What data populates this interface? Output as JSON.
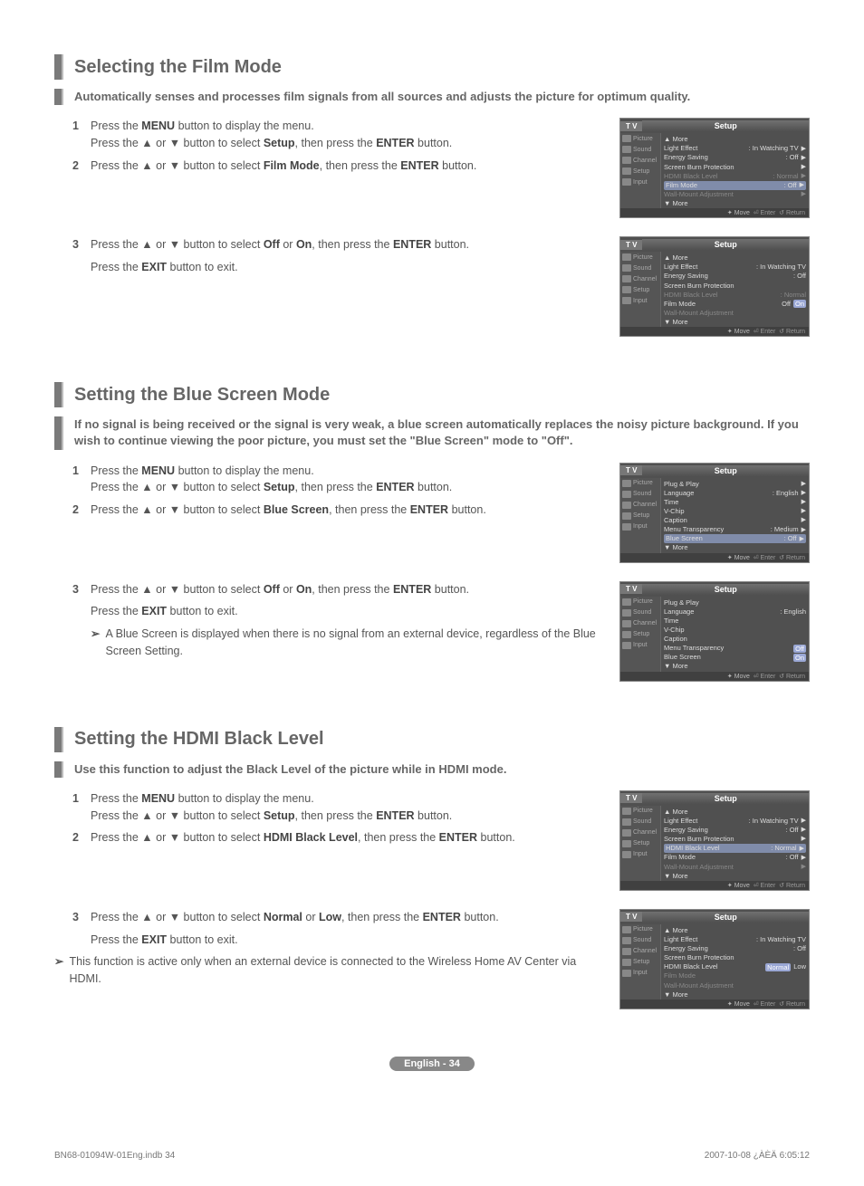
{
  "sections": [
    {
      "title": "Selecting the Film Mode",
      "subtitle": "Automatically senses and processes film signals from all sources and adjusts the picture for optimum quality.",
      "blocks": [
        {
          "steps": [
            {
              "n": "1",
              "pre": "Press the ",
              "b1": "MENU",
              "mid1": " button to display the menu.\nPress the ▲ or ▼ button to select ",
              "b2": "Setup",
              "mid2": ", then press the ",
              "b3": "ENTER",
              "post": " button."
            },
            {
              "n": "2",
              "pre": "Press the ▲ or ▼ button to select ",
              "b1": "Film Mode",
              "mid1": ", then press the ",
              "b2": "ENTER",
              "post": " button."
            }
          ],
          "osd": {
            "title": "Setup",
            "tv": "T V",
            "side": [
              "Picture",
              "Sound",
              "Channel",
              "Setup",
              "Input"
            ],
            "rows": [
              {
                "l": "▲ More",
                "type": "more"
              },
              {
                "l": "Light Effect",
                "r": ": In Watching TV",
                "arrow": true
              },
              {
                "l": "Energy Saving",
                "r": ": Off",
                "arrow": true
              },
              {
                "l": "Screen Burn Protection",
                "arrow": true
              },
              {
                "l": "HDMI Black Level",
                "r": ": Normal",
                "dim": true,
                "arrow": true
              },
              {
                "l": "Film Mode",
                "r": ": Off",
                "hl": true,
                "arrow": true
              },
              {
                "l": "Wall-Mount Adjustment",
                "dim": true,
                "arrow": true
              },
              {
                "l": "▼ More",
                "type": "more"
              }
            ],
            "foot": {
              "move": "Move",
              "enter": "Enter",
              "ret": "Return"
            }
          }
        },
        {
          "steps": [
            {
              "n": "3",
              "pre": "Press the ▲ or ▼ button to select ",
              "b1": "Off",
              "mid1": " or ",
              "b2": "On",
              "mid2": ", then press the ",
              "b3": "ENTER",
              "post": " button."
            },
            {
              "text": "Press the ",
              "b1": "EXIT",
              "post": " button to exit."
            }
          ],
          "osd": {
            "title": "Setup",
            "tv": "T V",
            "side": [
              "Picture",
              "Sound",
              "Channel",
              "Setup",
              "Input"
            ],
            "rows": [
              {
                "l": "▲ More",
                "type": "more"
              },
              {
                "l": "Light Effect",
                "r": ": In Watching TV"
              },
              {
                "l": "Energy Saving",
                "r": ": Off"
              },
              {
                "l": "Screen Burn Protection"
              },
              {
                "l": "HDMI Black Level",
                "r": ": Normal",
                "dim": true
              },
              {
                "l": "Film Mode",
                "opt1": "Off",
                "opt2": "On",
                "sel": 2
              },
              {
                "l": "Wall-Mount Adjustment",
                "dim": true
              },
              {
                "l": "▼ More",
                "type": "more"
              }
            ],
            "foot": {
              "move": "Move",
              "enter": "Enter",
              "ret": "Return"
            }
          }
        }
      ]
    },
    {
      "title": "Setting the Blue Screen Mode",
      "subtitle": "If no signal is being received or the signal is very weak, a blue screen automatically replaces the noisy picture background. If you wish to continue viewing the poor picture, you must set the \"Blue Screen\" mode to \"Off\".",
      "blocks": [
        {
          "steps": [
            {
              "n": "1",
              "pre": "Press the ",
              "b1": "MENU",
              "mid1": " button to display the menu.\nPress the ▲ or ▼ button to select ",
              "b2": "Setup",
              "mid2": ", then press the ",
              "b3": "ENTER",
              "post": " button."
            },
            {
              "n": "2",
              "pre": "Press the ▲ or ▼ button to select ",
              "b1": "Blue Screen",
              "mid1": ", then press the ",
              "b2": "ENTER",
              "post": " button."
            }
          ],
          "osd": {
            "title": "Setup",
            "tv": "T V",
            "side": [
              "Picture",
              "Sound",
              "Channel",
              "Setup",
              "Input"
            ],
            "rows": [
              {
                "l": "Plug & Play",
                "arrow": true
              },
              {
                "l": "Language",
                "r": ": English",
                "arrow": true
              },
              {
                "l": "Time",
                "arrow": true
              },
              {
                "l": "V-Chip",
                "arrow": true
              },
              {
                "l": "Caption",
                "arrow": true
              },
              {
                "l": "Menu Transparency",
                "r": ": Medium",
                "arrow": true
              },
              {
                "l": "Blue Screen",
                "r": ": Off",
                "hl": true,
                "arrow": true
              },
              {
                "l": "▼ More",
                "type": "more"
              }
            ],
            "foot": {
              "move": "Move",
              "enter": "Enter",
              "ret": "Return"
            }
          }
        },
        {
          "steps": [
            {
              "n": "3",
              "pre": "Press the ▲ or ▼ button to select ",
              "b1": "Off",
              "mid1": " or ",
              "b2": "On",
              "mid2": ", then press the ",
              "b3": "ENTER",
              "post": " button."
            },
            {
              "text": "Press the ",
              "b1": "EXIT",
              "post": " button to exit."
            }
          ],
          "notes": [
            "A Blue Screen is displayed when there is no signal from an external device, regardless of the Blue Screen Setting."
          ],
          "osd": {
            "title": "Setup",
            "tv": "T V",
            "side": [
              "Picture",
              "Sound",
              "Channel",
              "Setup",
              "Input"
            ],
            "rows": [
              {
                "l": "Plug & Play"
              },
              {
                "l": "Language",
                "r": ": English"
              },
              {
                "l": "Time"
              },
              {
                "l": "V-Chip"
              },
              {
                "l": "Caption"
              },
              {
                "l": "Menu Transparency",
                "opt1": "Off",
                "sel": 1
              },
              {
                "l": "Blue Screen",
                "opt2": "On",
                "sel": 2
              },
              {
                "l": "▼ More",
                "type": "more"
              }
            ],
            "foot": {
              "move": "Move",
              "enter": "Enter",
              "ret": "Return"
            }
          }
        }
      ]
    },
    {
      "title": "Setting the HDMI Black Level",
      "subtitle": "Use this function to adjust the Black Level of the picture while in HDMI mode.",
      "blocks": [
        {
          "steps": [
            {
              "n": "1",
              "pre": "Press the ",
              "b1": "MENU",
              "mid1": " button to display the menu.\nPress the ▲ or ▼ button to select ",
              "b2": "Setup",
              "mid2": ", then press the ",
              "b3": "ENTER",
              "post": " button."
            },
            {
              "n": "2",
              "pre": "Press the ▲ or ▼ button to select ",
              "b1": "HDMI Black Level",
              "mid1": ", then press the ",
              "b2": "ENTER",
              "post": " button."
            }
          ],
          "osd": {
            "title": "Setup",
            "tv": "T V",
            "side": [
              "Picture",
              "Sound",
              "Channel",
              "Setup",
              "Input"
            ],
            "rows": [
              {
                "l": "▲ More",
                "type": "more"
              },
              {
                "l": "Light Effect",
                "r": ": In Watching TV",
                "arrow": true
              },
              {
                "l": "Energy Saving",
                "r": ": Off",
                "arrow": true
              },
              {
                "l": "Screen Burn Protection",
                "arrow": true
              },
              {
                "l": "HDMI Black Level",
                "r": ": Normal",
                "hl": true,
                "arrow": true
              },
              {
                "l": "Film Mode",
                "r": ": Off",
                "arrow": true
              },
              {
                "l": "Wall-Mount Adjustment",
                "dim": true,
                "arrow": true
              },
              {
                "l": "▼ More",
                "type": "more"
              }
            ],
            "foot": {
              "move": "Move",
              "enter": "Enter",
              "ret": "Return"
            }
          }
        },
        {
          "steps": [
            {
              "n": "3",
              "pre": "Press the ▲ or ▼ button to select ",
              "b1": "Normal",
              "mid1": " or ",
              "b2": "Low",
              "mid2": ", then press the ",
              "b3": "ENTER",
              "post": " button."
            },
            {
              "text": "Press the ",
              "b1": "EXIT",
              "post": " button to exit."
            }
          ],
          "bottomNotes": [
            "This function is active only when an external device is connected to the Wireless Home AV Center via HDMI."
          ],
          "osd": {
            "title": "Setup",
            "tv": "T V",
            "side": [
              "Picture",
              "Sound",
              "Channel",
              "Setup",
              "Input"
            ],
            "rows": [
              {
                "l": "▲ More",
                "type": "more"
              },
              {
                "l": "Light Effect",
                "r": ": In Watching TV"
              },
              {
                "l": "Energy Saving",
                "r": ": Off"
              },
              {
                "l": "Screen Burn Protection"
              },
              {
                "l": "HDMI Black Level",
                "opt1": "Normal",
                "opt2": "Low",
                "sel": 1
              },
              {
                "l": "Film Mode",
                "dim": true
              },
              {
                "l": "Wall-Mount Adjustment",
                "dim": true
              },
              {
                "l": "▼ More",
                "type": "more"
              }
            ],
            "foot": {
              "move": "Move",
              "enter": "Enter",
              "ret": "Return"
            }
          }
        }
      ]
    }
  ],
  "page_badge": "English - 34",
  "footer": {
    "left": "BN68-01094W-01Eng.indb   34",
    "right": "2007-10-08   ¿ÀÈÄ 6:05:12"
  }
}
